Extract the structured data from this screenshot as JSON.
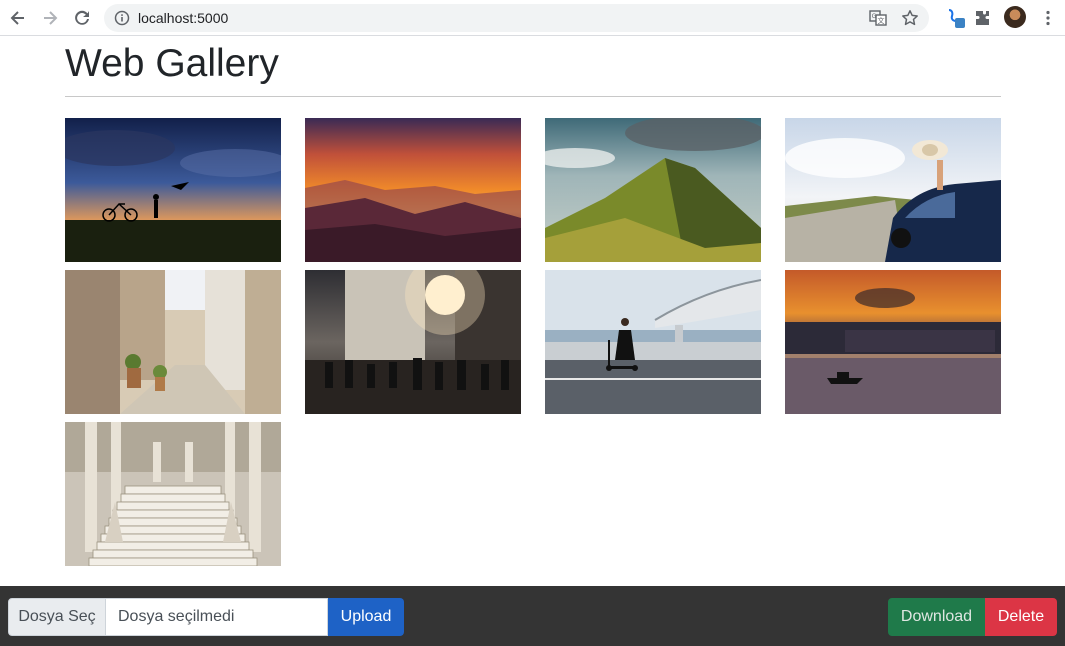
{
  "browser": {
    "url": "localhost:5000",
    "icons": [
      "back-icon",
      "forward-icon",
      "reload-icon",
      "info-icon",
      "translate-icon",
      "bookmark-star-icon",
      "extension-icon",
      "puzzle-icon",
      "profile-avatar",
      "menu-icon"
    ]
  },
  "page": {
    "title": "Web Gallery"
  },
  "gallery": {
    "images": [
      {
        "name": "bicycle-sunset"
      },
      {
        "name": "mountain-sunset"
      },
      {
        "name": "green-mountain"
      },
      {
        "name": "car-hat-road"
      },
      {
        "name": "stone-alley"
      },
      {
        "name": "city-street-crowd"
      },
      {
        "name": "scooter-bridge"
      },
      {
        "name": "river-city-sunset"
      },
      {
        "name": "marble-staircase"
      }
    ]
  },
  "toolbar": {
    "choose_label": "Dosya Seç",
    "file_name": "Dosya seçilmedi",
    "upload_label": "Upload",
    "download_label": "Download",
    "delete_label": "Delete"
  },
  "colors": {
    "bottom_bar": "#343434",
    "upload": "#1e62c6",
    "download": "#1f7a4a",
    "delete": "#dc3545"
  }
}
